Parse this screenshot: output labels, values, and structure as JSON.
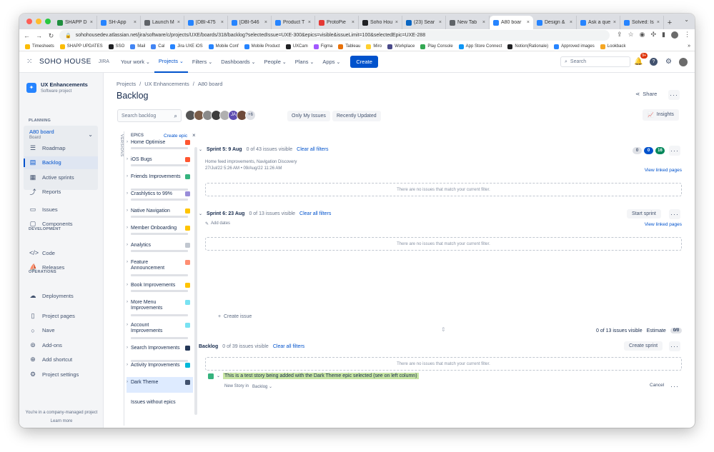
{
  "browser": {
    "tabs": [
      {
        "label": "SHAPP D",
        "color": "#1e8e3e"
      },
      {
        "label": "SH-App",
        "color": "#2684ff"
      },
      {
        "label": "Launch M",
        "color": "#5f6368"
      },
      {
        "label": "[DBI-475",
        "color": "#2684ff"
      },
      {
        "label": "[DBI-546",
        "color": "#2684ff"
      },
      {
        "label": "Product T",
        "color": "#2684ff"
      },
      {
        "label": "ProtoPie",
        "color": "#e53935"
      },
      {
        "label": "Soho Hou",
        "color": "#202124"
      },
      {
        "label": "(23) Sear",
        "color": "#0a66c2"
      },
      {
        "label": "New Tab",
        "color": "#5f6368"
      },
      {
        "label": "A80 boar",
        "color": "#2684ff",
        "active": true
      },
      {
        "label": "Design &",
        "color": "#2684ff"
      },
      {
        "label": "Ask a que",
        "color": "#2684ff"
      },
      {
        "label": "Solved: Is",
        "color": "#2684ff"
      }
    ],
    "url": "sohohousedev.atlassian.net/jira/software/c/projects/UXE/boards/318/backlog?selectedIssue=UXE-300&epics=visible&issueLimit=100&selectedEpic=UXE-288",
    "bookmarks": [
      "Timesheets",
      "SHAPP UPDATES",
      "SSO",
      "Mail",
      "Cal",
      "Jira UXE iOS",
      "Mobile Conf",
      "Mobile Product",
      "UXCam",
      "Figma",
      "Tableau",
      "Miro",
      "Workplace",
      "Play Console",
      "App Store Connect",
      "Notion(Rationale)",
      "Approved images",
      "Lookback"
    ],
    "bookmark_more": "»"
  },
  "jira": {
    "brand": "SOHO HOUSE",
    "product": "JIRA",
    "menu": [
      "Your work",
      "Projects",
      "Filters",
      "Dashboards",
      "People",
      "Plans",
      "Apps"
    ],
    "create": "Create",
    "search_placeholder": "Search",
    "notif_badge": "9+"
  },
  "sidebar": {
    "project_name": "UX Enhancements",
    "project_type": "Software project",
    "planning_label": "PLANNING",
    "board_name": "A80 board",
    "board_sub": "Board",
    "planning_items": [
      "Roadmap",
      "Backlog",
      "Active sprints",
      "Reports"
    ],
    "other_items": [
      "Issues",
      "Components"
    ],
    "dev_label": "DEVELOPMENT",
    "dev_items": [
      "Code",
      "Releases"
    ],
    "ops_label": "OPERATIONS",
    "ops_items": [
      "Deployments"
    ],
    "extra_items": [
      "Project pages",
      "Nave",
      "Add-ons",
      "Add shortcut",
      "Project settings"
    ],
    "footer_text": "You're in a company-managed project",
    "footer_link": "Learn more"
  },
  "content": {
    "breadcrumbs": [
      "Projects",
      "/",
      "UX Enhancements",
      "/",
      "A80 board"
    ],
    "title": "Backlog",
    "share": "Share",
    "search_placeholder": "Search backlog",
    "avatar_more": "+6",
    "only_my": "Only My Issues",
    "recent": "Recently Updated",
    "insights": "Insights",
    "versions_tab": "VERSIONS"
  },
  "epics": {
    "title": "EPICS",
    "create": "Create epic",
    "items": [
      {
        "name": "Home Optimise",
        "color": "#ff5630"
      },
      {
        "name": "iOS Bugs",
        "color": "#ff5630"
      },
      {
        "name": "Friends Improvements",
        "color": "#36b37e"
      },
      {
        "name": "Crashlytics to 99%",
        "color": "#998dd9"
      },
      {
        "name": "Native Navigation",
        "color": "#ffc400"
      },
      {
        "name": "Member Onboarding",
        "color": "#ffc400"
      },
      {
        "name": "Analytics",
        "color": "#c1c7d0"
      },
      {
        "name": "Feature Announcement",
        "color": "#ff8f73"
      },
      {
        "name": "Book Improvements",
        "color": "#ffc400"
      },
      {
        "name": "More Menu Improvements",
        "color": "#79e2f2"
      },
      {
        "name": "Account Improvements",
        "color": "#79e2f2"
      },
      {
        "name": "Search Improvements",
        "color": "#253858"
      },
      {
        "name": "Activity Improvements",
        "color": "#00b8d9"
      },
      {
        "name": "Dark Theme",
        "color": "#42526e"
      }
    ],
    "no_epic": "Issues without epics"
  },
  "sprint5": {
    "name": "Sprint 5: 9 Aug",
    "count": "0 of 43 issues visible",
    "clear": "Clear all filters",
    "goal": "Home feed improvements, Navigation Discovery",
    "dates": "27/Jul/22 5:26 AM • 09/Aug/22 11:26 AM",
    "pills": [
      "0",
      "0",
      "16"
    ],
    "view_linked": "View linked pages",
    "empty": "There are no issues that match your current filter."
  },
  "sprint6": {
    "name": "Sprint 6: 23 Aug",
    "count": "0 of 13 issues visible",
    "clear": "Clear all filters",
    "add_dates": "Add dates",
    "start": "Start sprint",
    "view_linked": "View linked pages",
    "empty": "There are no issues that match your current filter.",
    "create_issue": "Create issue",
    "visible_count": "0 of 13 issues visible",
    "estimate": "Estimate",
    "estimate_val": "0/0"
  },
  "backlog": {
    "name": "Backlog",
    "count": "0 of 39 issues visible",
    "clear": "Clear all filters",
    "create_sprint": "Create sprint",
    "empty": "There are no issues that match your current filter.",
    "new_issue_text": "This is a test story being added with the Dark Theme epic selected (see on left column)",
    "new_story_in": "New Story in",
    "backlog_select": "Backlog",
    "cancel": "Cancel"
  }
}
